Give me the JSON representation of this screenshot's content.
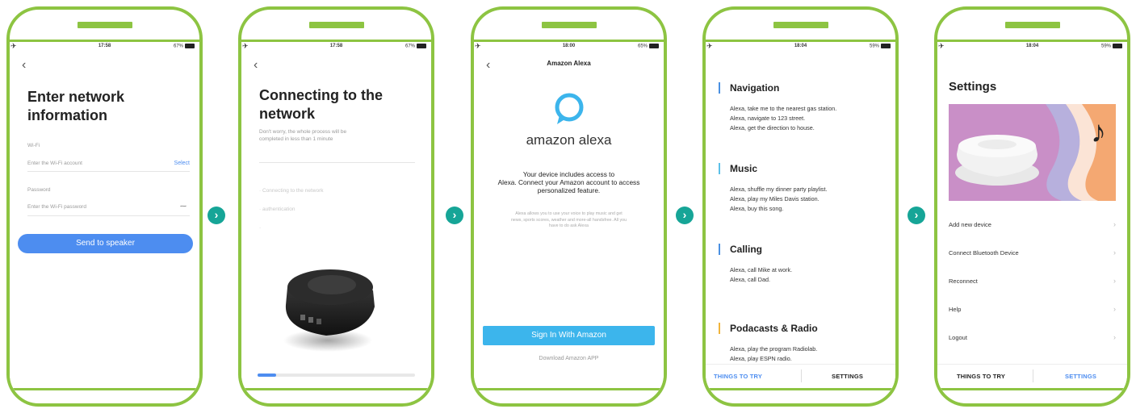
{
  "phones": [
    {
      "time": "17:58",
      "battery": "67%",
      "title_line1": "Enter network",
      "title_line2": "information",
      "wifi_label": "Wi-Fi",
      "wifi_placeholder": "Enter the Wi-Fi account",
      "select_label": "Select",
      "password_label": "Password",
      "password_placeholder": "Enter the Wi-Fi password",
      "send_button": "Send to speaker"
    },
    {
      "time": "17:58",
      "battery": "67%",
      "title_line1": "Connecting to the",
      "title_line2": "network",
      "desc_line1": "Don't worry, the whole process will be",
      "desc_line2": "completed in less than 1 minute",
      "step1": "· Connecting to the network",
      "step2": "· authentication",
      "step3": "·",
      "progress": 0.12
    },
    {
      "time": "18:00",
      "battery": "65%",
      "header": "Amazon Alexa",
      "logo_text": "amazon alexa",
      "intro_line1": "Your device includes access to",
      "intro_line2": "Alexa. Connect your Amazon account to access",
      "intro_line3": "personalized feature.",
      "small_line1": "Alexa allows you to use your voice to play music and get",
      "small_line2": "news, sports scores, weather and more-all handsfree. All you",
      "small_line3": "have to do ask Alexa",
      "sign_in": "Sign In With Amazon",
      "download": "Download Amazon APP"
    },
    {
      "time": "18:04",
      "battery": "59%",
      "sections": [
        {
          "title": "Navigation",
          "color": "#4a90e2",
          "lines": [
            "Alexa, take me to the nearest gas station.",
            "Alexa, navigate to 123 street.",
            "Alexa, get the direction to house."
          ]
        },
        {
          "title": "Music",
          "color": "#5bc0e8",
          "lines": [
            "Alexa, shuffle my dinner party playlist.",
            "Alexa, play my Miles Davis station.",
            "Alexa, buy this song."
          ]
        },
        {
          "title": "Calling",
          "color": "#4a90e2",
          "lines": [
            "Alexa, call Mike at work.",
            "Alexa, call Dad."
          ]
        },
        {
          "title": "Podacasts & Radio",
          "color": "#f0b43c",
          "lines": [
            "Alexa, play the program Radiolab.",
            "Alexa, play ESPN radio."
          ]
        }
      ],
      "tab_things": "THINGS TO TRY",
      "tab_settings": "SETTINGS"
    },
    {
      "time": "18:04",
      "battery": "59%",
      "title": "Settings",
      "menu": [
        "Add new device",
        "Connect Bluetooth Device",
        "Reconnect",
        "Help",
        "Logout"
      ],
      "tab_things": "THINGS TO TRY",
      "tab_settings": "SETTINGS"
    }
  ],
  "colors": {
    "frame": "#8dc442",
    "chevron": "#16a597",
    "accent_blue": "#4d8df0",
    "alexa_blue": "#3cb5ec"
  },
  "icons": [
    "airplane-icon",
    "back-chevron-icon",
    "eye-toggle-icon",
    "next-step-chevron-icon",
    "alexa-ring-logo",
    "music-note-icon",
    "row-arrow-icon"
  ]
}
